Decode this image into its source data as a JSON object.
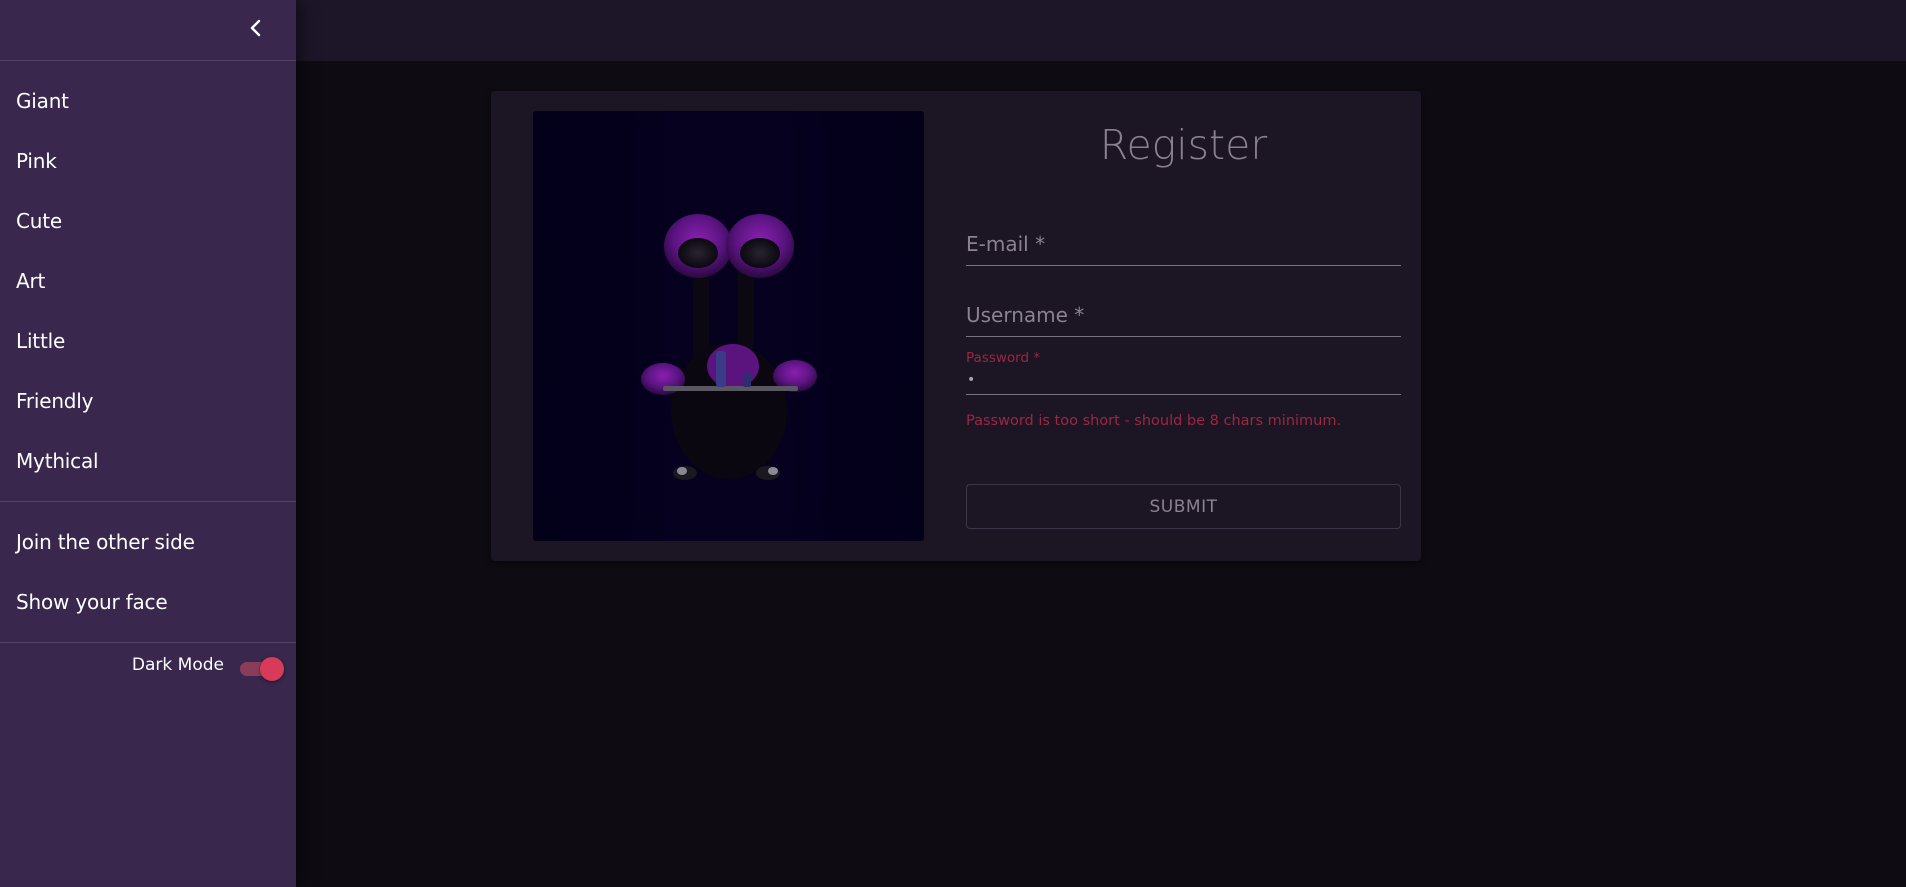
{
  "sidebar": {
    "collapse_icon": "chevron-left-icon",
    "items": [
      {
        "label": "Giant"
      },
      {
        "label": "Pink"
      },
      {
        "label": "Cute"
      },
      {
        "label": "Art"
      },
      {
        "label": "Little"
      },
      {
        "label": "Friendly"
      },
      {
        "label": "Mythical"
      }
    ],
    "secondary_items": [
      {
        "label": "Join the other side"
      },
      {
        "label": "Show your face"
      }
    ],
    "dark_mode": {
      "label": "Dark Mode",
      "enabled": true
    }
  },
  "register": {
    "title": "Register",
    "email_label": "E-mail *",
    "username_label": "Username *",
    "password_label": "Password *",
    "password_value": "•",
    "password_error": "Password is too short - should be 8 chars minimum.",
    "submit_label": "SUBMIT"
  },
  "colors": {
    "drawer_bg": "#39274d",
    "appbar_bg": "#1d1628",
    "page_bg": "#0e0c12",
    "card_bg": "#1c1523",
    "error": "#9b2744",
    "toggle_accent": "#d83a5a"
  }
}
